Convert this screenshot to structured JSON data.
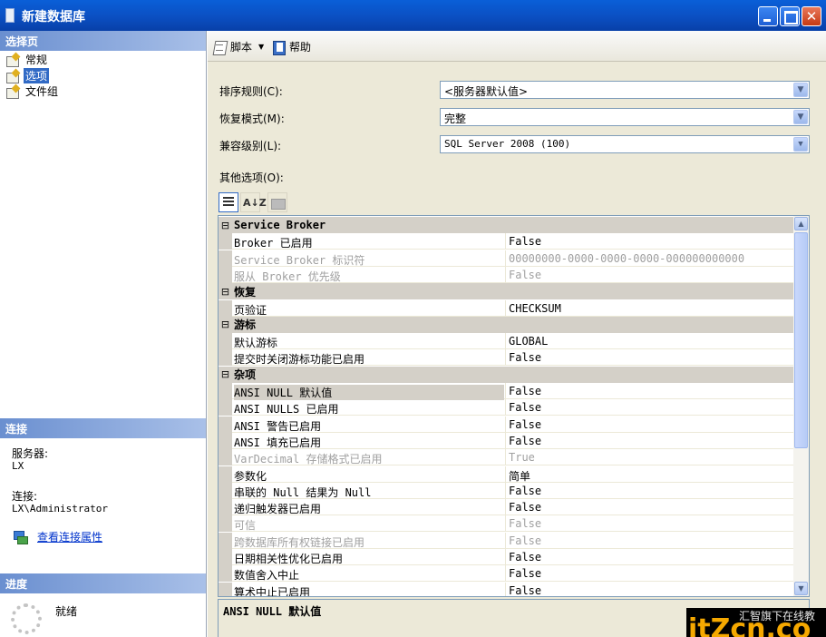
{
  "window": {
    "title": "新建数据库",
    "close_glyph": "✕"
  },
  "left": {
    "select_page_header": "选择页",
    "pages": [
      {
        "label": "常规",
        "selected": false
      },
      {
        "label": "选项",
        "selected": true
      },
      {
        "label": "文件组",
        "selected": false
      }
    ],
    "connection_header": "连接",
    "server_label": "服务器:",
    "server_value": "LX",
    "connection_label": "连接:",
    "connection_value": "LX\\Administrator",
    "view_connection_link": "查看连接属性",
    "progress_header": "进度",
    "progress_status": "就绪"
  },
  "toolbar": {
    "script_label": "脚本",
    "help_label": "帮助",
    "dropdown_glyph": "▼"
  },
  "form": {
    "collation_label": "排序规则(C):",
    "collation_value": "<服务器默认值>",
    "recovery_label": "恢复模式(M):",
    "recovery_value": "完整",
    "compat_label": "兼容级别(L):",
    "compat_value": "SQL Server 2008 (100)",
    "other_label": "其他选项(O):",
    "dropdown_glyph": "▼"
  },
  "grid": {
    "rows": [
      {
        "kind": "cat",
        "name": "Service Broker"
      },
      {
        "kind": "prop",
        "name": "Broker 已启用",
        "value": "False"
      },
      {
        "kind": "prop",
        "name": "Service Broker 标识符",
        "value": "00000000-0000-0000-0000-000000000000",
        "disabled": true
      },
      {
        "kind": "prop",
        "name": "服从 Broker 优先级",
        "value": "False",
        "disabled": true
      },
      {
        "kind": "cat",
        "name": "恢复"
      },
      {
        "kind": "prop",
        "name": "页验证",
        "value": "CHECKSUM"
      },
      {
        "kind": "cat",
        "name": "游标"
      },
      {
        "kind": "prop",
        "name": "默认游标",
        "value": "GLOBAL"
      },
      {
        "kind": "prop",
        "name": "提交时关闭游标功能已启用",
        "value": "False"
      },
      {
        "kind": "cat",
        "name": "杂项"
      },
      {
        "kind": "prop",
        "name": "ANSI NULL 默认值",
        "value": "False",
        "selected": true
      },
      {
        "kind": "prop",
        "name": "ANSI NULLS 已启用",
        "value": "False"
      },
      {
        "kind": "prop",
        "name": "ANSI 警告已启用",
        "value": "False"
      },
      {
        "kind": "prop",
        "name": "ANSI 填充已启用",
        "value": "False"
      },
      {
        "kind": "prop",
        "name": "VarDecimal 存储格式已启用",
        "value": "True",
        "disabled": true
      },
      {
        "kind": "prop",
        "name": "参数化",
        "value": "简单"
      },
      {
        "kind": "prop",
        "name": "串联的 Null 结果为 Null",
        "value": "False"
      },
      {
        "kind": "prop",
        "name": "递归触发器已启用",
        "value": "False"
      },
      {
        "kind": "prop",
        "name": "可信",
        "value": "False",
        "disabled": true
      },
      {
        "kind": "prop",
        "name": "跨数据库所有权链接已启用",
        "value": "False",
        "disabled": true
      },
      {
        "kind": "prop",
        "name": "日期相关性优化已启用",
        "value": "False"
      },
      {
        "kind": "prop",
        "name": "数值舍入中止",
        "value": "False"
      },
      {
        "kind": "prop",
        "name": "算术中止已启用",
        "value": "False"
      }
    ],
    "collapse_glyph": "⊟",
    "scroll_up_glyph": "▲",
    "scroll_down_glyph": "▼",
    "sort_glyph": "A↓Z"
  },
  "description": {
    "title": "ANSI NULL 默认值"
  },
  "watermark": {
    "text": "汇智旗下在线教",
    "logo": "itZcn.co"
  }
}
